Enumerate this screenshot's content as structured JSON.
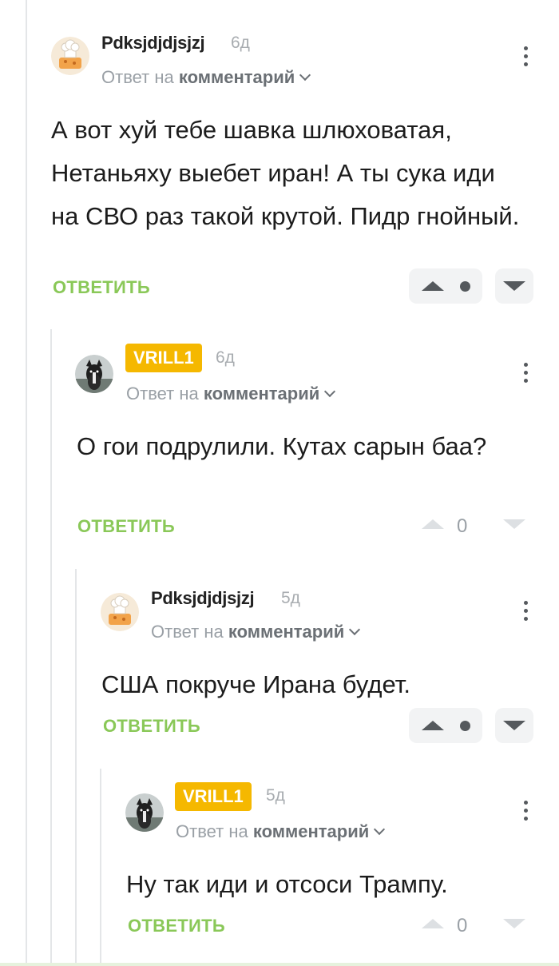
{
  "comments": [
    {
      "username": "Pdksjdjdjsjzj",
      "age": "6д",
      "reply_prefix": "Ответ на",
      "reply_target": "комментарий",
      "text": "А вот хуй тебе шавка шлюховатая, Нетаньяху выебет иран! А ты сука иди на СВО раз такой крутой. Пидр гнойный.",
      "reply_label": "ОТВЕТИТЬ",
      "rating_shown": false
    },
    {
      "username": "VRILL1",
      "age": "6д",
      "reply_prefix": "Ответ на",
      "reply_target": "комментарий",
      "text": "О гои подрулили. Кутах сарын баа?",
      "reply_label": "ОТВЕТИТЬ",
      "rating_shown": true,
      "score": "0"
    },
    {
      "username": "Pdksjdjdjsjzj",
      "age": "5д",
      "reply_prefix": "Ответ на",
      "reply_target": "комментарий",
      "text": "США покруче Ирана будет.",
      "reply_label": "ОТВЕТИТЬ",
      "rating_shown": false
    },
    {
      "username": "VRILL1",
      "age": "5д",
      "reply_prefix": "Ответ на",
      "reply_target": "комментарий",
      "text": "Ну так иди и отсоси Трампу.",
      "reply_label": "ОТВЕТИТЬ",
      "rating_shown": true,
      "score": "0"
    }
  ],
  "colors": {
    "reply_green": "#8ac858",
    "author_badge": "#f5b800",
    "thread_line": "#e4e6e8"
  }
}
